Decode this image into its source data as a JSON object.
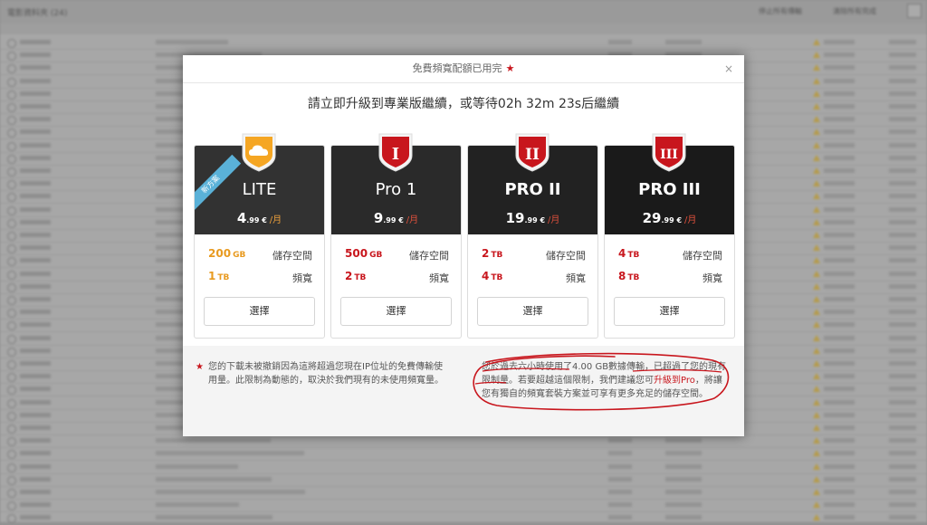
{
  "background": {
    "app_title": "電影資料夾 (24)",
    "btn_1": "停止所有傳輸",
    "btn_2": "清除所有完成"
  },
  "modal": {
    "title": "免費頻寬配額已用完",
    "title_star": "★",
    "close": "×",
    "subtitle": "請立即升級到專業版繼續，或等待02h 32m 23s后繼續"
  },
  "plans": [
    {
      "name": "LITE",
      "ribbon": "新方案",
      "price_int": "4",
      "price_dec": ".99 €",
      "per": "/月",
      "storage_val": "200",
      "storage_unit": "GB",
      "storage_label": "儲存空間",
      "bandwidth_val": "1",
      "bandwidth_unit": "TB",
      "bandwidth_label": "頻寬",
      "button": "選擇",
      "badge": "cloud-shield-icon",
      "accent": "#f0a23c"
    },
    {
      "name": "Pro 1",
      "price_int": "9",
      "price_dec": ".99 €",
      "per": "/月",
      "storage_val": "500",
      "storage_unit": "GB",
      "storage_label": "儲存空間",
      "bandwidth_val": "2",
      "bandwidth_unit": "TB",
      "bandwidth_label": "頻寬",
      "button": "選擇",
      "badge_text": "I",
      "accent": "#c8161d"
    },
    {
      "name": "PRO II",
      "price_int": "19",
      "price_dec": ".99 €",
      "per": "/月",
      "storage_val": "2",
      "storage_unit": "TB",
      "storage_label": "儲存空間",
      "bandwidth_val": "4",
      "bandwidth_unit": "TB",
      "bandwidth_label": "頻寬",
      "button": "選擇",
      "badge_text": "II",
      "accent": "#c8161d"
    },
    {
      "name": "PRO III",
      "price_int": "29",
      "price_dec": ".99 €",
      "per": "/月",
      "storage_val": "4",
      "storage_unit": "TB",
      "storage_label": "儲存空間",
      "bandwidth_val": "8",
      "bandwidth_unit": "TB",
      "bandwidth_label": "頻寬",
      "button": "選擇",
      "badge_text": "III",
      "accent": "#c8161d"
    }
  ],
  "footer": {
    "star": "★",
    "left_note": "您的下載未被撤銷因為這將超過您現在IP位址的免費傳輸使用量。此限制為動態的，取決於我們現有的未使用頻寬量。",
    "right_note_a": "您於過去六小時使用了4.00 GB數據傳輸，已超過了您的現有限制量。若要超越這個限制，我們建議您可",
    "right_note_hl": "升級到Pro",
    "right_note_b": "，將讓您有獨自的頻寬套裝方案並可享有更多充足的儲存空間。"
  }
}
